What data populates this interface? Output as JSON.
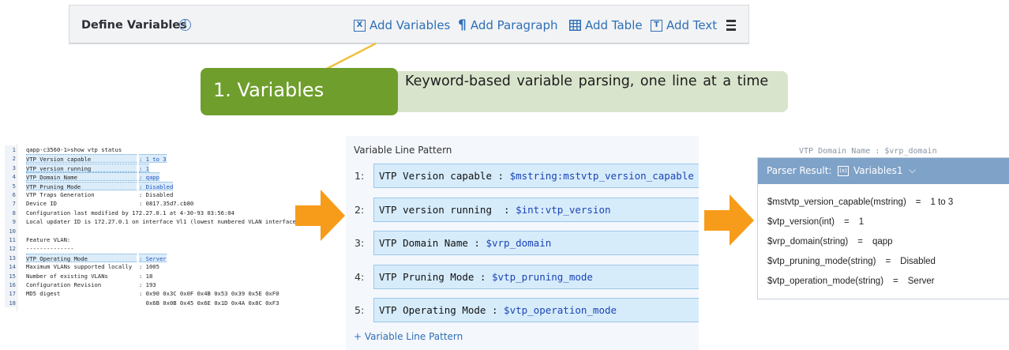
{
  "toolbar": {
    "title": "Define Variables",
    "info_icon": "info-icon",
    "buttons": [
      {
        "label": "Add Variables",
        "icon": "x-box-icon"
      },
      {
        "label": "Add Paragraph",
        "icon": "pilcrow-icon"
      },
      {
        "label": "Add Table",
        "icon": "table-icon"
      },
      {
        "label": "Add Text",
        "icon": "text-box-icon"
      }
    ],
    "menu_icon": "hamburger-menu-icon"
  },
  "callout": {
    "label": "1. Variables",
    "description": "Keyword-based variable parsing, one line at a time",
    "label_bg": "#6f9e2d",
    "desc_bg": "#d9e4cc"
  },
  "terminal": {
    "lines": [
      {
        "num": "1",
        "text": "qapp-c3560-1>show vtp status"
      },
      {
        "num": "2",
        "key": "VTP Version capable",
        "val": ": 1 to 3",
        "hl": true
      },
      {
        "num": "3",
        "key": "VTP version running",
        "val": ": 1",
        "hl": true
      },
      {
        "num": "4",
        "key": "VTP Domain Name",
        "val": ": qapp",
        "hl": true
      },
      {
        "num": "5",
        "key": "VTP Pruning Mode",
        "val": ": Disabled",
        "hl": true
      },
      {
        "num": "6",
        "key": "VTP Traps Generation",
        "val": ": Disabled"
      },
      {
        "num": "7",
        "key": "Device ID",
        "val": ": 0817.35d7.cb80"
      },
      {
        "num": "8",
        "text": "Configuration last modified by 172.27.0.1 at 4-30-93 03:56:04"
      },
      {
        "num": "9",
        "text": "Local updater ID is 172.27.0.1 on interface Vl1 (lowest numbered VLAN interface found)"
      },
      {
        "num": "10",
        "text": ""
      },
      {
        "num": "11",
        "text": "Feature VLAN:"
      },
      {
        "num": "12",
        "text": "--------------"
      },
      {
        "num": "13",
        "key": "VTP Operating Mode",
        "val": ": Server",
        "hl": true
      },
      {
        "num": "14",
        "key": "Maximum VLANs supported locally",
        "val": ": 1005"
      },
      {
        "num": "15",
        "key": "Number of existing VLANs",
        "val": ": 18"
      },
      {
        "num": "16",
        "key": "Configuration Revision",
        "val": ": 193"
      },
      {
        "num": "17",
        "key": "MD5 digest",
        "val": ": 0x90 0x3C 0x0F 0x4B 0x53 0x39 0x5E 0xF0"
      },
      {
        "num": "18",
        "key": "",
        "val": "  0x6B 0x0B 0x45 0x6E 0x1D 0x4A 0x8C 0xF3"
      }
    ]
  },
  "pattern": {
    "title": "Variable Line Pattern",
    "rows": [
      {
        "num": "1:",
        "prefix": "VTP Version capable : ",
        "var": "$mstring:mstvtp_version_capable"
      },
      {
        "num": "2:",
        "prefix": "VTP version running  : ",
        "var": "$int:vtp_version"
      },
      {
        "num": "3:",
        "prefix": "VTP Domain Name : ",
        "var": "$vrp_domain"
      },
      {
        "num": "4:",
        "prefix": "VTP Pruning Mode : ",
        "var": "$vtp_pruning_mode"
      },
      {
        "num": "5:",
        "prefix": "VTP Operating Mode : ",
        "var": "$vtp_operation_mode"
      }
    ],
    "add_label": "+ Variable Line Pattern"
  },
  "parser": {
    "behind_text": "VTP Domain Name : $vrp_domain",
    "header_label": "Parser Result:",
    "selected": "Variables1",
    "header_icon": "x-box-icon",
    "chevron": "chevron-down-icon",
    "header_color": "#7fa2c8",
    "results": [
      {
        "name": "$mstvtp_version_capable(mstring)",
        "value": "1 to 3"
      },
      {
        "name": "$vtp_version(int)",
        "value": "1"
      },
      {
        "name": "$vrp_domain(string)",
        "value": "qapp"
      },
      {
        "name": "$vtp_pruning_mode(string)",
        "value": "Disabled"
      },
      {
        "name": "$vtp_operation_mode(string)",
        "value": "Server"
      }
    ]
  },
  "colors": {
    "arrow": "#f79c1a",
    "link": "#2f6fb6",
    "field_bg": "#d7ecfb"
  }
}
